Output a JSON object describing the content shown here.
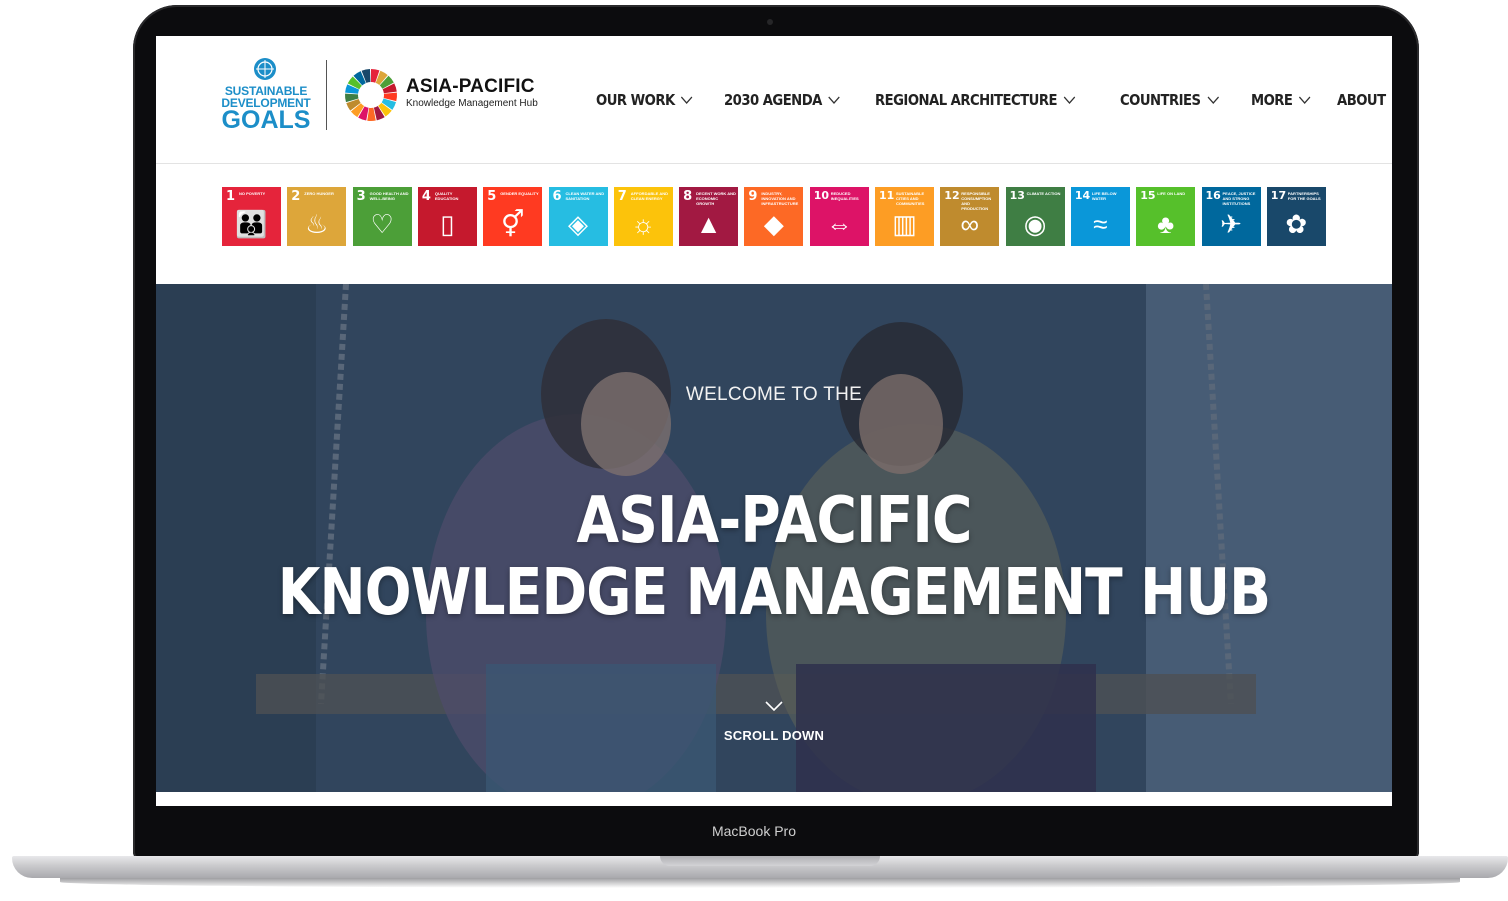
{
  "device": {
    "label": "MacBook Pro"
  },
  "header": {
    "sdg_logo": {
      "line1": "SUSTAINABLE",
      "line2": "DEVELOPMENT",
      "line3": "GOALS"
    },
    "hub_logo": {
      "title": "ASIA-PACIFIC",
      "subtitle": "Knowledge Management Hub"
    }
  },
  "nav": {
    "items": [
      {
        "label": "OUR WORK"
      },
      {
        "label": "2030 AGENDA"
      },
      {
        "label": "REGIONAL ARCHITECTURE"
      },
      {
        "label": "COUNTRIES"
      },
      {
        "label": "MORE"
      },
      {
        "label": "ABOUT"
      }
    ]
  },
  "goals": [
    {
      "num": "1",
      "label": "NO POVERTY",
      "color": "#e5243b",
      "icon": "people-icon"
    },
    {
      "num": "2",
      "label": "ZERO HUNGER",
      "color": "#dda63a",
      "icon": "bowl-icon"
    },
    {
      "num": "3",
      "label": "GOOD HEALTH AND WELL-BEING",
      "color": "#4c9f38",
      "icon": "heartbeat-icon"
    },
    {
      "num": "4",
      "label": "QUALITY EDUCATION",
      "color": "#c5192d",
      "icon": "book-icon"
    },
    {
      "num": "5",
      "label": "GENDER EQUALITY",
      "color": "#ff3a21",
      "icon": "gender-icon"
    },
    {
      "num": "6",
      "label": "CLEAN WATER AND SANITATION",
      "color": "#26bde2",
      "icon": "water-icon"
    },
    {
      "num": "7",
      "label": "AFFORDABLE AND CLEAN ENERGY",
      "color": "#fcc30b",
      "icon": "sun-icon"
    },
    {
      "num": "8",
      "label": "DECENT WORK AND ECONOMIC GROWTH",
      "color": "#a21942",
      "icon": "growth-icon"
    },
    {
      "num": "9",
      "label": "INDUSTRY, INNOVATION AND INFRASTRUCTURE",
      "color": "#fd6925",
      "icon": "cubes-icon"
    },
    {
      "num": "10",
      "label": "REDUCED INEQUALITIES",
      "color": "#dd1367",
      "icon": "equality-icon"
    },
    {
      "num": "11",
      "label": "SUSTAINABLE CITIES AND COMMUNITIES",
      "color": "#fd9d24",
      "icon": "city-icon"
    },
    {
      "num": "12",
      "label": "RESPONSIBLE CONSUMPTION AND PRODUCTION",
      "color": "#bf8b2e",
      "icon": "infinity-icon"
    },
    {
      "num": "13",
      "label": "CLIMATE ACTION",
      "color": "#3f7e44",
      "icon": "eye-icon"
    },
    {
      "num": "14",
      "label": "LIFE BELOW WATER",
      "color": "#0a97d9",
      "icon": "fish-icon"
    },
    {
      "num": "15",
      "label": "LIFE ON LAND",
      "color": "#56c02b",
      "icon": "tree-icon"
    },
    {
      "num": "16",
      "label": "PEACE, JUSTICE AND STRONG INSTITUTIONS",
      "color": "#00689d",
      "icon": "dove-icon"
    },
    {
      "num": "17",
      "label": "PARTNERSHIPS FOR THE GOALS",
      "color": "#19486a",
      "icon": "flower-icon"
    }
  ],
  "hero": {
    "welcome": "WELCOME TO THE",
    "title_line1": "ASIA-PACIFIC",
    "title_line2": "KNOWLEDGE MANAGEMENT HUB",
    "scroll_label": "SCROLL DOWN"
  }
}
